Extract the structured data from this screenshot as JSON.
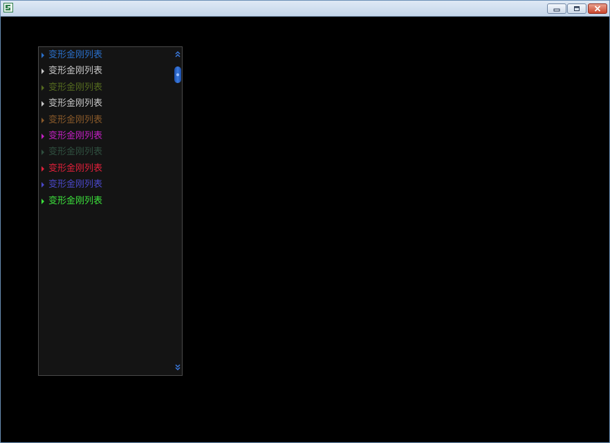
{
  "window": {
    "icon": "app-icon",
    "controls": [
      "minimize-icon",
      "maximize-icon",
      "close-icon"
    ],
    "colors": {
      "frame": "#6a8fb5",
      "client_background": "#000000",
      "close_button": "#c9452c"
    }
  },
  "list": {
    "background": "#141414",
    "items": [
      {
        "label": "变形金刚列表",
        "color": "#2a6fc9"
      },
      {
        "label": "变形金刚列表",
        "color": "#c8c8c8"
      },
      {
        "label": "变形金刚列表",
        "color": "#556b1f"
      },
      {
        "label": "变形金刚列表",
        "color": "#c8c8c8"
      },
      {
        "label": "变形金刚列表",
        "color": "#8a5a2a"
      },
      {
        "label": "变形金刚列表",
        "color": "#c21fc2"
      },
      {
        "label": "变形金刚列表",
        "color": "#2f4f3f"
      },
      {
        "label": "变形金刚列表",
        "color": "#e0203a"
      },
      {
        "label": "变形金刚列表",
        "color": "#4a48c8"
      },
      {
        "label": "变形金刚列表",
        "color": "#3ce03c"
      }
    ],
    "scrollbar": {
      "up_icon": "double-chevron-up-icon",
      "down_icon": "double-chevron-down-icon",
      "thumb_color": "#3a7ae0",
      "position": 0
    }
  }
}
